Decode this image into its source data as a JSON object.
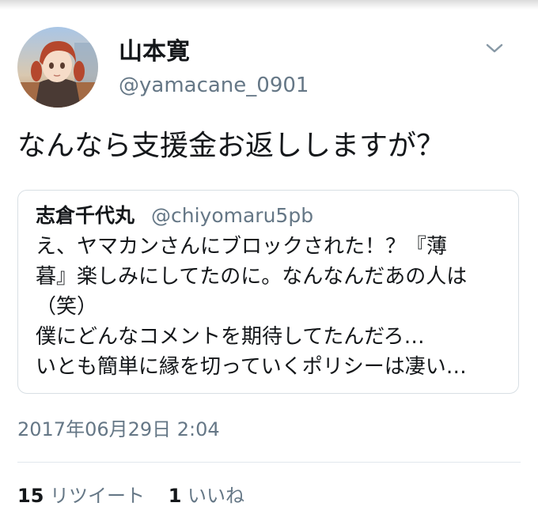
{
  "tweet": {
    "display_name": "山本寛",
    "handle": "@yamacane_0901",
    "text": "なんなら支援金お返ししますが？",
    "timestamp": "2017年06月29日 2:04",
    "menu_icon": "chevron-down-icon"
  },
  "quoted_tweet": {
    "display_name": "志倉千代丸",
    "handle": "@chiyomaru5pb",
    "lines": [
      "え、ヤマカンさんにブロックされた！？『薄",
      "暮』楽しみにしてたのに。なんなんだあの人は",
      "（笑）",
      "僕にどんなコメントを期待してたんだろ…",
      "いとも簡単に縁を切っていくポリシーは凄い…"
    ]
  },
  "stats": {
    "retweets": {
      "count": "15",
      "label": "リツイート"
    },
    "likes": {
      "count": "1",
      "label": "いいね"
    }
  },
  "colors": {
    "text_primary": "#14171a",
    "text_secondary": "#657786",
    "border": "#d8dfe4",
    "divider": "#e1e8ed"
  }
}
